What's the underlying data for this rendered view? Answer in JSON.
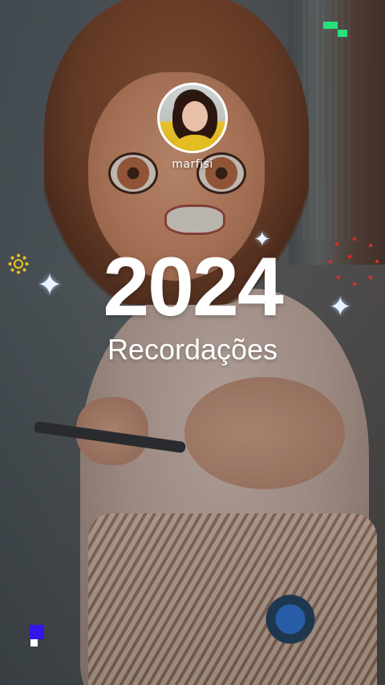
{
  "profile": {
    "username": "marfisi"
  },
  "title": {
    "year": "2024",
    "subtitle": "Recordações"
  },
  "decorations": {
    "sparkle_glyph": "✦",
    "accent_green": "#27e07a",
    "accent_blue": "#3414e8",
    "accent_red": "#e02a2a",
    "accent_yellow": "#f2c21b"
  }
}
